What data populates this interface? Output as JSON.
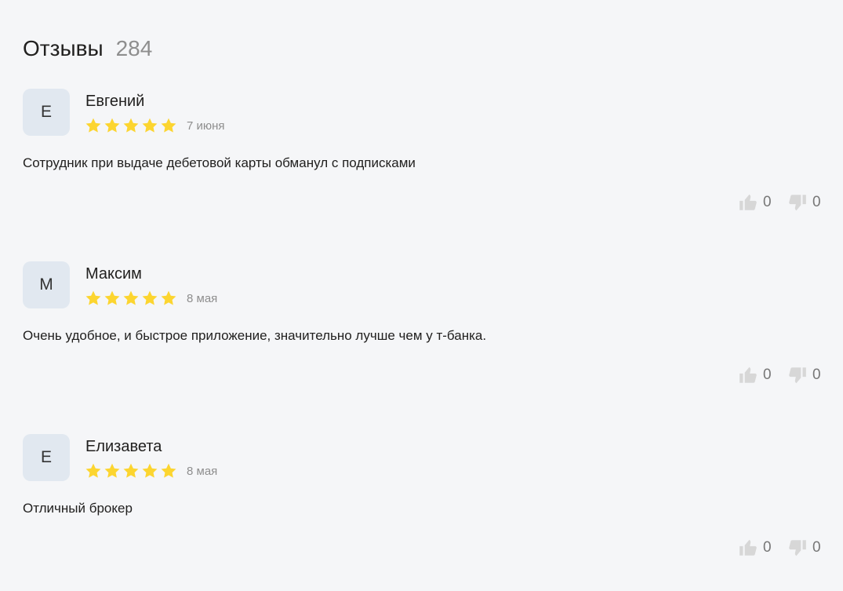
{
  "header": {
    "title": "Отзывы",
    "count": "284"
  },
  "colors": {
    "star": "#fcd530",
    "avatar_bg": "#e1e8f0",
    "muted_text": "#8e8e8e",
    "vote_icon": "#d7d7d7"
  },
  "reviews": [
    {
      "initial": "Е",
      "author": "Евгений",
      "rating": 5,
      "date": "7 июня",
      "text": "Сотрудник при выдаче дебетовой карты обманул с подписками",
      "likes": "0",
      "dislikes": "0"
    },
    {
      "initial": "М",
      "author": "Максим",
      "rating": 5,
      "date": "8 мая",
      "text": "Очень удобное, и быстрое приложение, значительно лучше чем у т-банка.",
      "likes": "0",
      "dislikes": "0"
    },
    {
      "initial": "Е",
      "author": "Елизавета",
      "rating": 5,
      "date": "8 мая",
      "text": "Отличный брокер",
      "likes": "0",
      "dislikes": "0"
    }
  ]
}
